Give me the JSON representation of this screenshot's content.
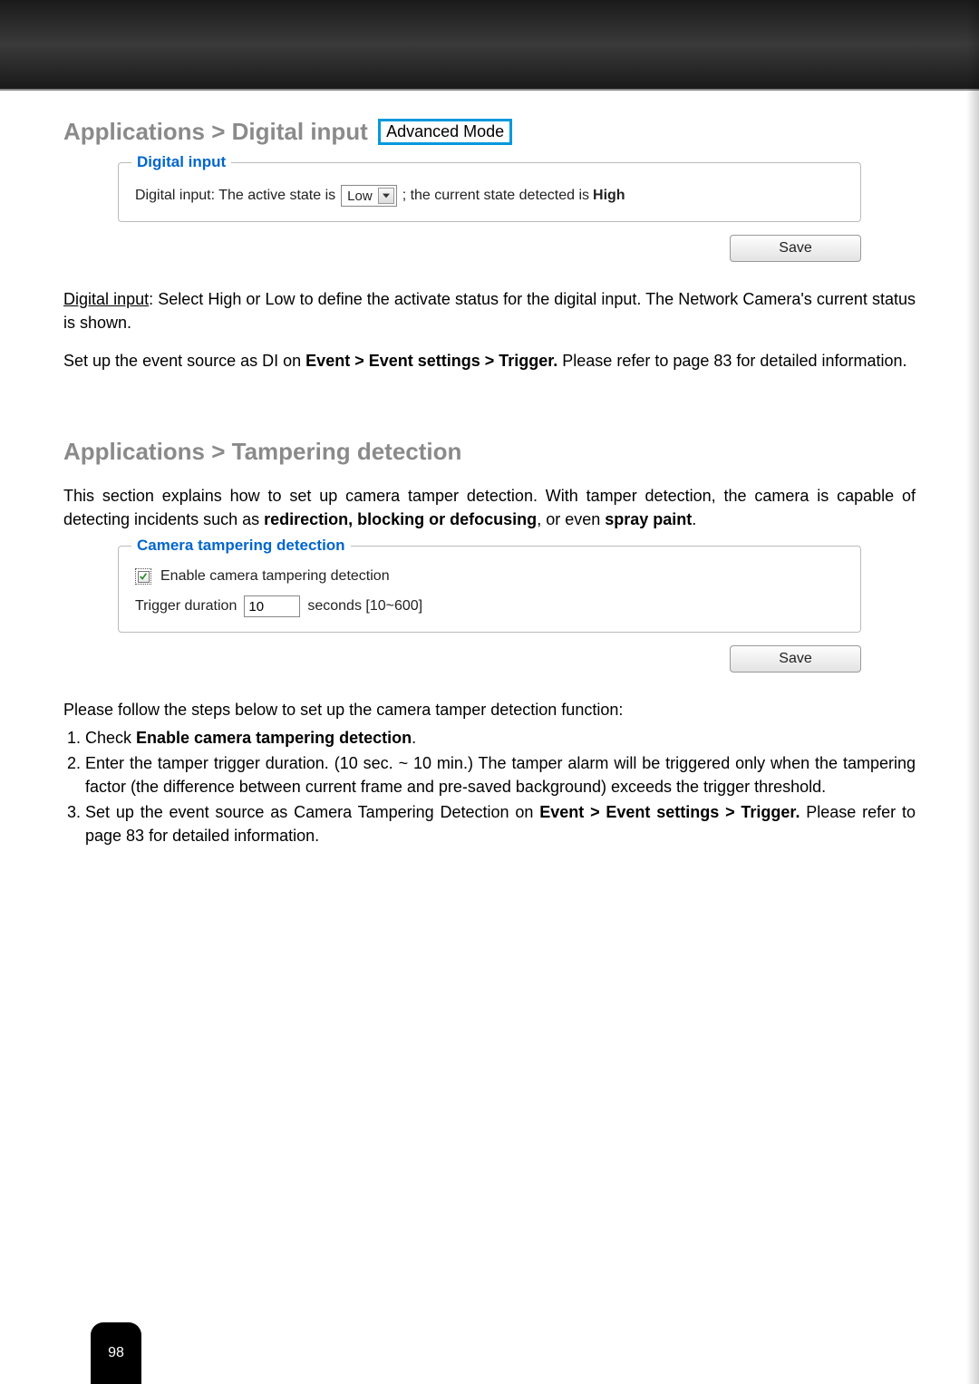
{
  "section1": {
    "heading": "Applications > Digital input",
    "badge": "Advanced Mode",
    "fieldset": {
      "legend": "Digital input",
      "label_prefix": "Digital input: The active state is",
      "select_value": "Low",
      "label_mid": "; the current state detected is",
      "state_value": "High"
    },
    "save_label": "Save",
    "para1_a": "Digital input",
    "para1_b": ": Select High or Low to define the activate status for the digital input. The Network Camera's current status is shown.",
    "para2_a": "Set up the event source as DI on ",
    "para2_b": "Event > Event settings > Trigger.",
    "para2_c": " Please refer to page 83 for detailed information."
  },
  "section2": {
    "heading": "Applications > Tampering detection",
    "intro_a": "This section explains how to set up camera tamper detection. With tamper detection, the camera is capable of detecting incidents such as ",
    "intro_b": "redirection, blocking or defocusing",
    "intro_c": ", or even ",
    "intro_d": "spray paint",
    "intro_e": ".",
    "fieldset": {
      "legend": "Camera tampering detection",
      "checkbox_label": "Enable camera tampering detection",
      "trigger_label": "Trigger duration",
      "trigger_value": "10",
      "trigger_suffix": "seconds [10~600]"
    },
    "save_label": "Save",
    "steps_intro": "Please follow the steps below to set up the camera tamper detection function:",
    "step1_a": "Check ",
    "step1_b": "Enable camera tampering detection",
    "step1_c": ".",
    "step2": "Enter the tamper trigger duration. (10 sec. ~ 10 min.) The tamper alarm will be triggered only when the tampering factor (the difference between current frame and pre-saved background) exceeds the trigger threshold.",
    "step3_a": "Set up the event source as Camera Tampering Detection on ",
    "step3_b": "Event > Event settings > Trigger.",
    "step3_c": " Please refer to page 83 for detailed information."
  },
  "page_number": "98"
}
